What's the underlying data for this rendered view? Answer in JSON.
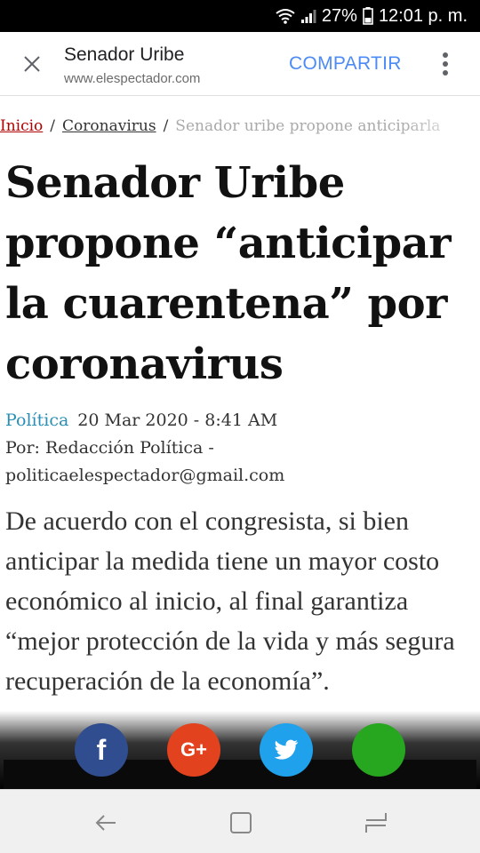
{
  "status_bar": {
    "battery": "27%",
    "time": "12:01 p. m."
  },
  "toolbar": {
    "title": "Senador Uribe",
    "url": "www.elespectador.com",
    "share_label": "COMPARTIR"
  },
  "breadcrumb": {
    "home": "Inicio",
    "section": "Coronavirus",
    "current": "Senador uribe propone anticiparla"
  },
  "article": {
    "headline": "Senador Uribe propone “anticipar la cuarentena” por coronavirus",
    "section": "Política",
    "date": "20 Mar 2020 - 8:41 AM",
    "byline": "Por: Redacción Política - politicaelespectador@gmail.com",
    "lead": "De acuerdo con el congresista, si bien anticipar la medida tiene un mayor costo económico al inicio, al final garantiza “mejor protección de la vida y más segura recuperación de la economía”."
  },
  "share_bar": {
    "facebook_glyph": "f",
    "google_glyph": "G+",
    "colors": {
      "facebook": "#2f4d8f",
      "google": "#e3421f",
      "twitter": "#1fa1ec",
      "whatsapp": "#27a61f"
    }
  }
}
